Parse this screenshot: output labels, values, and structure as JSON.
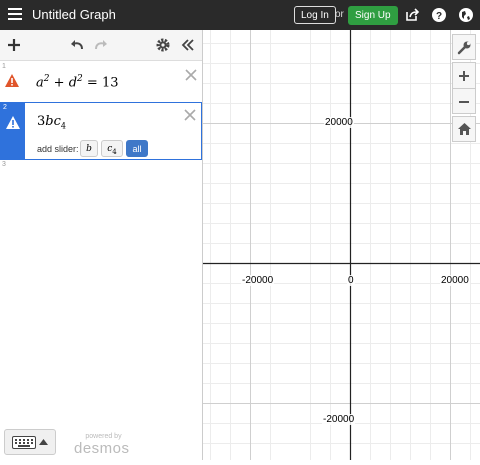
{
  "app": {
    "title": "Untitled Graph",
    "login_label": "Log In",
    "or_label": "or",
    "signup_label": "Sign Up",
    "signup_color": "#2f9e41"
  },
  "expressions": [
    {
      "index": "1",
      "latex_parts": {
        "a": "a",
        "a_exp": "2",
        "plus": "+",
        "d": "d",
        "d_exp": "2",
        "eq": "=",
        "rhs": "13"
      },
      "status_icon": "warning-icon"
    },
    {
      "index": "2",
      "latex_parts": {
        "coef": "3",
        "b": "b",
        "c": "c",
        "c_sub": "4"
      },
      "status_icon": "warning-icon",
      "slider": {
        "label": "add slider:",
        "options": [
          "b",
          "c",
          "4",
          "all"
        ]
      }
    },
    {
      "index": "3"
    }
  ],
  "graph": {
    "x_ticks": [
      "-20000",
      "0",
      "20000"
    ],
    "y_ticks": [
      "20000",
      "-20000"
    ]
  },
  "footer": {
    "powered_label": "powered by",
    "brand": "desmos"
  },
  "icons": [
    "menu-icon",
    "share-icon",
    "help-icon",
    "globe-icon",
    "plus-icon",
    "undo-icon",
    "redo-icon",
    "settings-icon",
    "collapse-icon",
    "wrench-icon",
    "zoom-in-icon",
    "zoom-out-icon",
    "home-icon",
    "keyboard-icon",
    "close-icon"
  ]
}
